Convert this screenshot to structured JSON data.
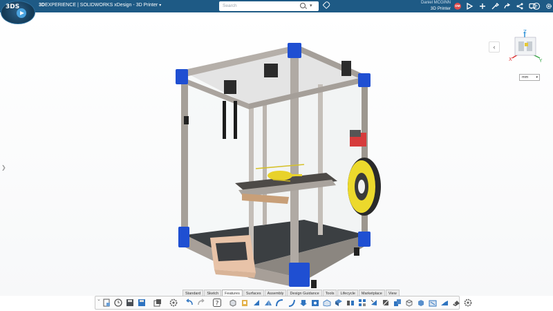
{
  "topbar": {
    "brand_bold": "3D",
    "brand_rest": "EXPERIENCE | SOLIDWORKS xDesign - 3D Printer",
    "search_placeholder": "Search",
    "user_name": "Daniel MCGINN",
    "user_context": "3D Printer",
    "avatar_initials": "DM",
    "accent": "#1e5a85",
    "icons": [
      "share-icon",
      "add-icon",
      "tools-icon",
      "forward-icon",
      "network-icon",
      "comment-icon",
      "help-icon",
      "settings-icon"
    ]
  },
  "viewport": {
    "units": "mm",
    "triad_labels": {
      "z": "Z",
      "x": "X",
      "y": "Y"
    }
  },
  "actionbar": {
    "tabs": [
      "Standard",
      "Sketch",
      "Features",
      "Surfaces",
      "Assembly",
      "Design Guidance",
      "Tools",
      "Lifecycle",
      "Marketplace",
      "View"
    ],
    "active_tab": "Features"
  }
}
